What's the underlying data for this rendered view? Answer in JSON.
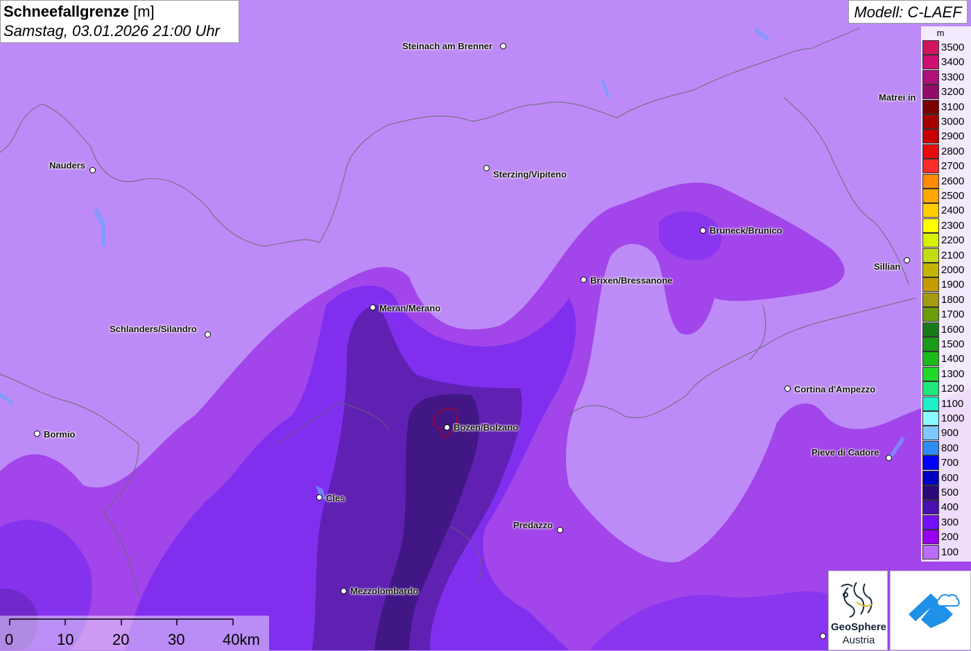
{
  "title": {
    "main": "Schneefallgrenze",
    "unit": "[m]",
    "datetime": "Samstag, 03.01.2026 21:00 Uhr"
  },
  "model": "Modell: C-LAEF",
  "legend": {
    "unit": "m",
    "entries": [
      {
        "label": "3500",
        "color": "#d4145e"
      },
      {
        "label": "3400",
        "color": "#cc0f70"
      },
      {
        "label": "3300",
        "color": "#b0107a"
      },
      {
        "label": "3200",
        "color": "#930c6a"
      },
      {
        "label": "3100",
        "color": "#7a0000"
      },
      {
        "label": "3000",
        "color": "#a40000"
      },
      {
        "label": "2900",
        "color": "#c60000"
      },
      {
        "label": "2800",
        "color": "#e80a0a"
      },
      {
        "label": "2700",
        "color": "#ff2a2a"
      },
      {
        "label": "2600",
        "color": "#ff8a00"
      },
      {
        "label": "2500",
        "color": "#ffa600"
      },
      {
        "label": "2400",
        "color": "#ffcc00"
      },
      {
        "label": "2300",
        "color": "#ffff00"
      },
      {
        "label": "2200",
        "color": "#d8ef00"
      },
      {
        "label": "2100",
        "color": "#c4dc14"
      },
      {
        "label": "2000",
        "color": "#c2b500"
      },
      {
        "label": "1900",
        "color": "#c49b00"
      },
      {
        "label": "1800",
        "color": "#a39b12"
      },
      {
        "label": "1700",
        "color": "#6b9c0c"
      },
      {
        "label": "1600",
        "color": "#197a19"
      },
      {
        "label": "1500",
        "color": "#1a9a1a"
      },
      {
        "label": "1400",
        "color": "#1bb91b"
      },
      {
        "label": "1300",
        "color": "#22d62a"
      },
      {
        "label": "1200",
        "color": "#21e67b"
      },
      {
        "label": "1100",
        "color": "#1ef0c8"
      },
      {
        "label": "1000",
        "color": "#8bfaff"
      },
      {
        "label": "900",
        "color": "#7fc8ff"
      },
      {
        "label": "800",
        "color": "#2f8cf0"
      },
      {
        "label": "700",
        "color": "#0000ff"
      },
      {
        "label": "600",
        "color": "#0000c0"
      },
      {
        "label": "500",
        "color": "#2a0a7a"
      },
      {
        "label": "400",
        "color": "#4a10b0"
      },
      {
        "label": "300",
        "color": "#7310ff"
      },
      {
        "label": "200",
        "color": "#9900ee"
      },
      {
        "label": "100",
        "color": "#bb6cfa"
      }
    ]
  },
  "places": [
    {
      "name": "Steinach am Brenner"
    },
    {
      "name": "Matrei in"
    },
    {
      "name": "Nauders"
    },
    {
      "name": "Sterzing/Vipiteno"
    },
    {
      "name": "Bruneck/Brunico"
    },
    {
      "name": "Sillian"
    },
    {
      "name": "Brixen/Bressanone"
    },
    {
      "name": "Meran/Merano"
    },
    {
      "name": "Schlanders/Silandro"
    },
    {
      "name": "Cortina d'Ampezzo"
    },
    {
      "name": "Bormio"
    },
    {
      "name": "Bozen/Bolzano"
    },
    {
      "name": "Pieve di Cadore"
    },
    {
      "name": "Cles"
    },
    {
      "name": "Predazzo"
    },
    {
      "name": "Mezzolombardo"
    }
  ],
  "scale": {
    "labels": [
      "0",
      "10",
      "20",
      "30",
      "40km"
    ]
  },
  "logo": {
    "name": "GeoSphere",
    "sub": "Austria"
  }
}
